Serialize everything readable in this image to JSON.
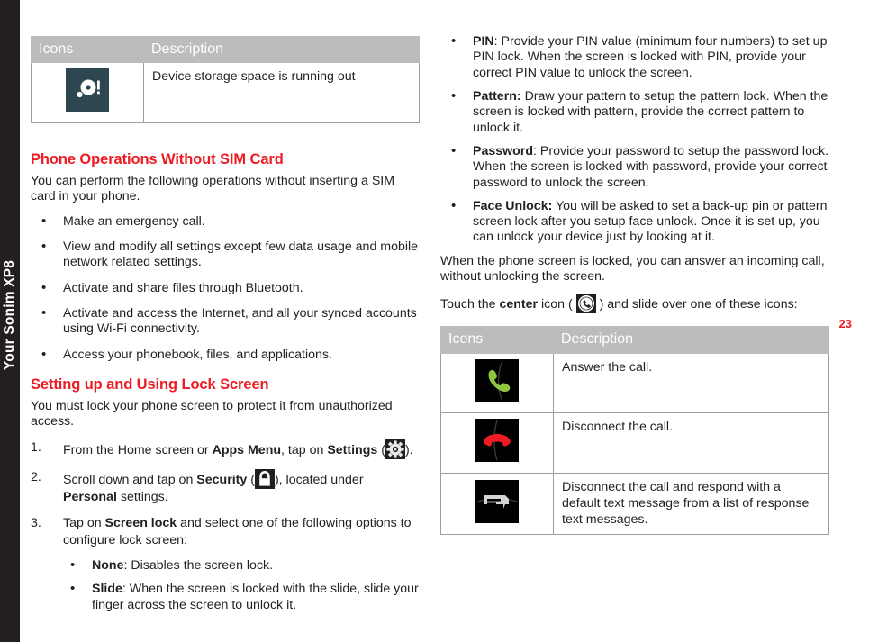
{
  "spine": {
    "label": "Your Sonim XP8"
  },
  "page": {
    "number": "23"
  },
  "tables": {
    "headers": {
      "icons": "Icons",
      "description": "Description"
    },
    "storage": {
      "rows": [
        {
          "icon": "device-storage-icon",
          "description": "Device storage space is running out"
        }
      ]
    },
    "call_actions": {
      "rows": [
        {
          "icon": "answer-call-icon",
          "description": "Answer the call."
        },
        {
          "icon": "end-call-icon",
          "description": "Disconnect the call."
        },
        {
          "icon": "respond-message-icon",
          "description": "Disconnect the call and respond with a default text message from a list of response text messages."
        }
      ]
    }
  },
  "sim_section": {
    "heading": "Phone Operations Without SIM Card",
    "intro": "You can perform the following operations without inserting a SIM card in your phone.",
    "bullets": [
      "Make an emergency call.",
      "View and modify all settings except few data usage and mobile network related settings.",
      "Activate and share files through Bluetooth.",
      "Activate and access the Internet, and all your synced accounts using Wi-Fi connectivity.",
      "Access your phonebook, files, and applications."
    ]
  },
  "lock_section": {
    "heading": "Setting up and Using Lock Screen",
    "intro": "You must lock your phone screen to protect it from unauthorized access.",
    "steps": [
      {
        "parts": [
          {
            "t": "From the Home screen or ",
            "b": false
          },
          {
            "t": "Apps Menu",
            "b": true
          },
          {
            "t": ", tap on ",
            "b": false
          },
          {
            "t": "Settings",
            "b": true
          },
          {
            "t": " (",
            "b": false
          },
          {
            "icon": "settings-gear-icon"
          },
          {
            "t": ").",
            "b": false
          }
        ]
      },
      {
        "parts": [
          {
            "t": "Scroll down and tap on ",
            "b": false
          },
          {
            "t": "Security",
            "b": true
          },
          {
            "t": " (",
            "b": false
          },
          {
            "icon": "security-lock-icon"
          },
          {
            "t": "), located under ",
            "b": false
          },
          {
            "t": "Personal",
            "b": true
          },
          {
            "t": " settings.",
            "b": false
          }
        ]
      },
      {
        "parts": [
          {
            "t": "Tap on ",
            "b": false
          },
          {
            "t": "Screen lock",
            "b": true
          },
          {
            "t": " and select one of the following options to configure lock screen:",
            "b": false
          }
        ]
      }
    ],
    "options": [
      {
        "term": "None",
        "sep": ": ",
        "body": "Disables the screen lock."
      },
      {
        "term": "Slide",
        "sep": ": ",
        "body": "When the screen is locked with the slide, slide your finger across the screen to unlock it."
      },
      {
        "term": "PIN",
        "sep": ": ",
        "body": "Provide your PIN value (minimum four numbers) to set up PIN lock. When the screen is locked with PIN, provide your correct PIN value to unlock the screen."
      },
      {
        "term": "Pattern:",
        "sep": " ",
        "body": "Draw your pattern to setup the pattern lock. When the screen is locked with pattern, provide the correct pattern to unlock it."
      },
      {
        "term": "Password",
        "sep": ": ",
        "body": "Provide your password to setup the password lock. When the screen is locked with password, provide your correct password to unlock the screen."
      },
      {
        "term": "Face Unlock:",
        "sep": " ",
        "body": "You will be asked to set a back-up pin or pattern screen lock after you setup face unlock. Once it is set up, you can unlock your device just by looking at it."
      }
    ],
    "locked_note": "When the phone screen is locked, you can answer an incoming call, without unlocking the screen.",
    "touch_line": {
      "pre": "Touch the ",
      "bold": "center",
      "mid": " icon ( ",
      "icon": "incoming-call-center-icon",
      "post": " ) and slide over one of these icons:"
    }
  },
  "colors": {
    "accent_red": "#ed1c24",
    "spine_black": "#231f20",
    "table_header_gray": "#bcbcbc",
    "storage_icon_bg": "#2c4750",
    "answer_green": "#8ec63f",
    "end_red": "#ed1c24"
  }
}
